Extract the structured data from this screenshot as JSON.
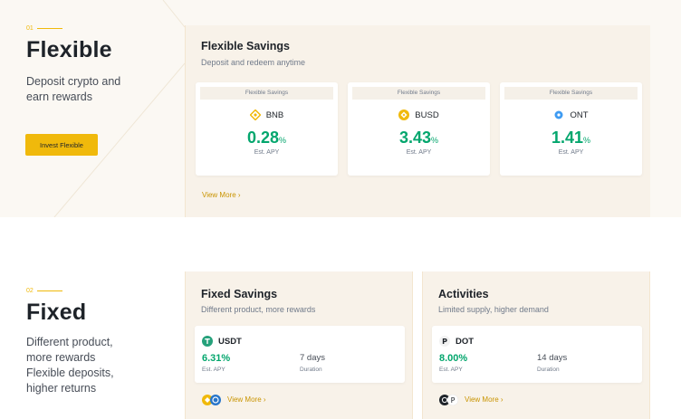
{
  "flexible": {
    "number": "01",
    "title": "Flexible",
    "description": [
      "Deposit crypto and",
      "earn rewards"
    ],
    "button": "Invest Flexible",
    "panel": {
      "title": "Flexible Savings",
      "subtitle": "Deposit and redeem anytime",
      "cards": [
        {
          "header": "Flexible Savings",
          "coin": "BNB",
          "apy": "0.28",
          "unit": "%",
          "label": "Est. APY",
          "icon": "bnb-icon"
        },
        {
          "header": "Flexible Savings",
          "coin": "BUSD",
          "apy": "3.43",
          "unit": "%",
          "label": "Est. APY",
          "icon": "busd-icon"
        },
        {
          "header": "Flexible Savings",
          "coin": "ONT",
          "apy": "1.41",
          "unit": "%",
          "label": "Est. APY",
          "icon": "ont-icon"
        }
      ],
      "view_more": "View More ›"
    }
  },
  "fixed": {
    "number": "02",
    "title": "Fixed",
    "description": [
      "Different product,",
      "more rewards",
      "Flexible deposits,",
      "higher returns"
    ],
    "fixed_panel": {
      "title": "Fixed Savings",
      "subtitle": "Different product, more rewards",
      "coin": "USDT",
      "rate": "6.31%",
      "rate_label": "Est. APY",
      "duration": "7 days",
      "duration_label": "Duration",
      "view_more": "View More ›"
    },
    "activities_panel": {
      "title": "Activities",
      "subtitle": "Limited supply, higher demand",
      "coin": "DOT",
      "rate": "8.00%",
      "rate_label": "Est. APY",
      "duration": "14 days",
      "duration_label": "Duration",
      "view_more": "View More ›"
    }
  },
  "colors": {
    "accent": "#f0b90b",
    "green": "#03a66d",
    "panel_bg": "#f8f2e9"
  }
}
